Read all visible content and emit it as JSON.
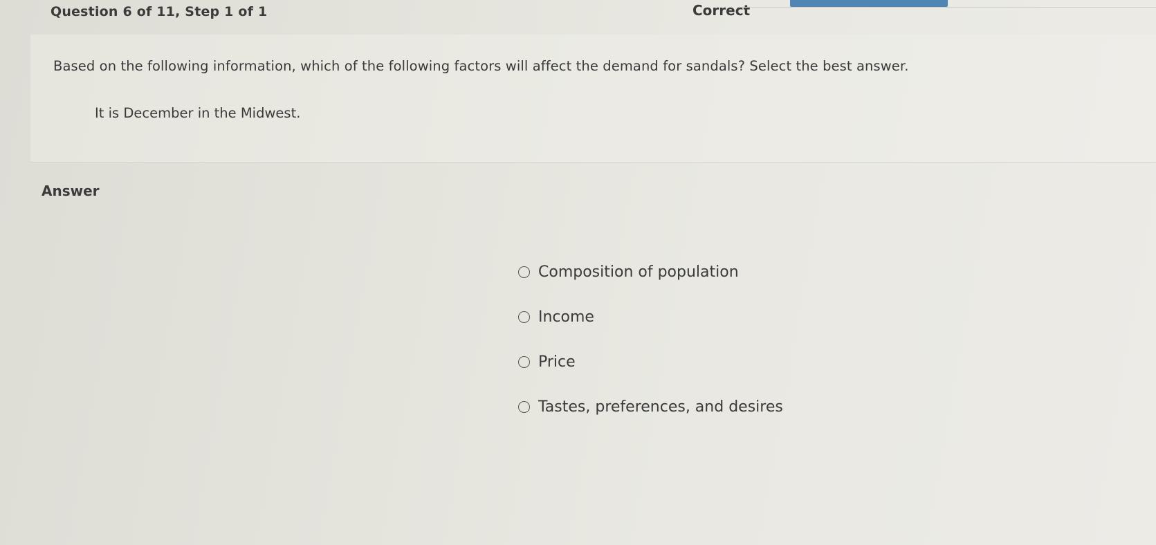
{
  "header": {
    "question_counter": "Question 6 of 11,  Step 1 of 1",
    "status": "Correct",
    "accent_color": "#4f86b4"
  },
  "question": {
    "prompt": "Based on the following information, which of the following factors will affect the demand for sandals? Select the best answer.",
    "context": "It is December in the Midwest."
  },
  "answer": {
    "heading": "Answer",
    "options": [
      {
        "label": "Composition of population",
        "selected": false
      },
      {
        "label": "Income",
        "selected": false
      },
      {
        "label": "Price",
        "selected": false
      },
      {
        "label": "Tastes, preferences, and desires",
        "selected": false
      }
    ]
  }
}
